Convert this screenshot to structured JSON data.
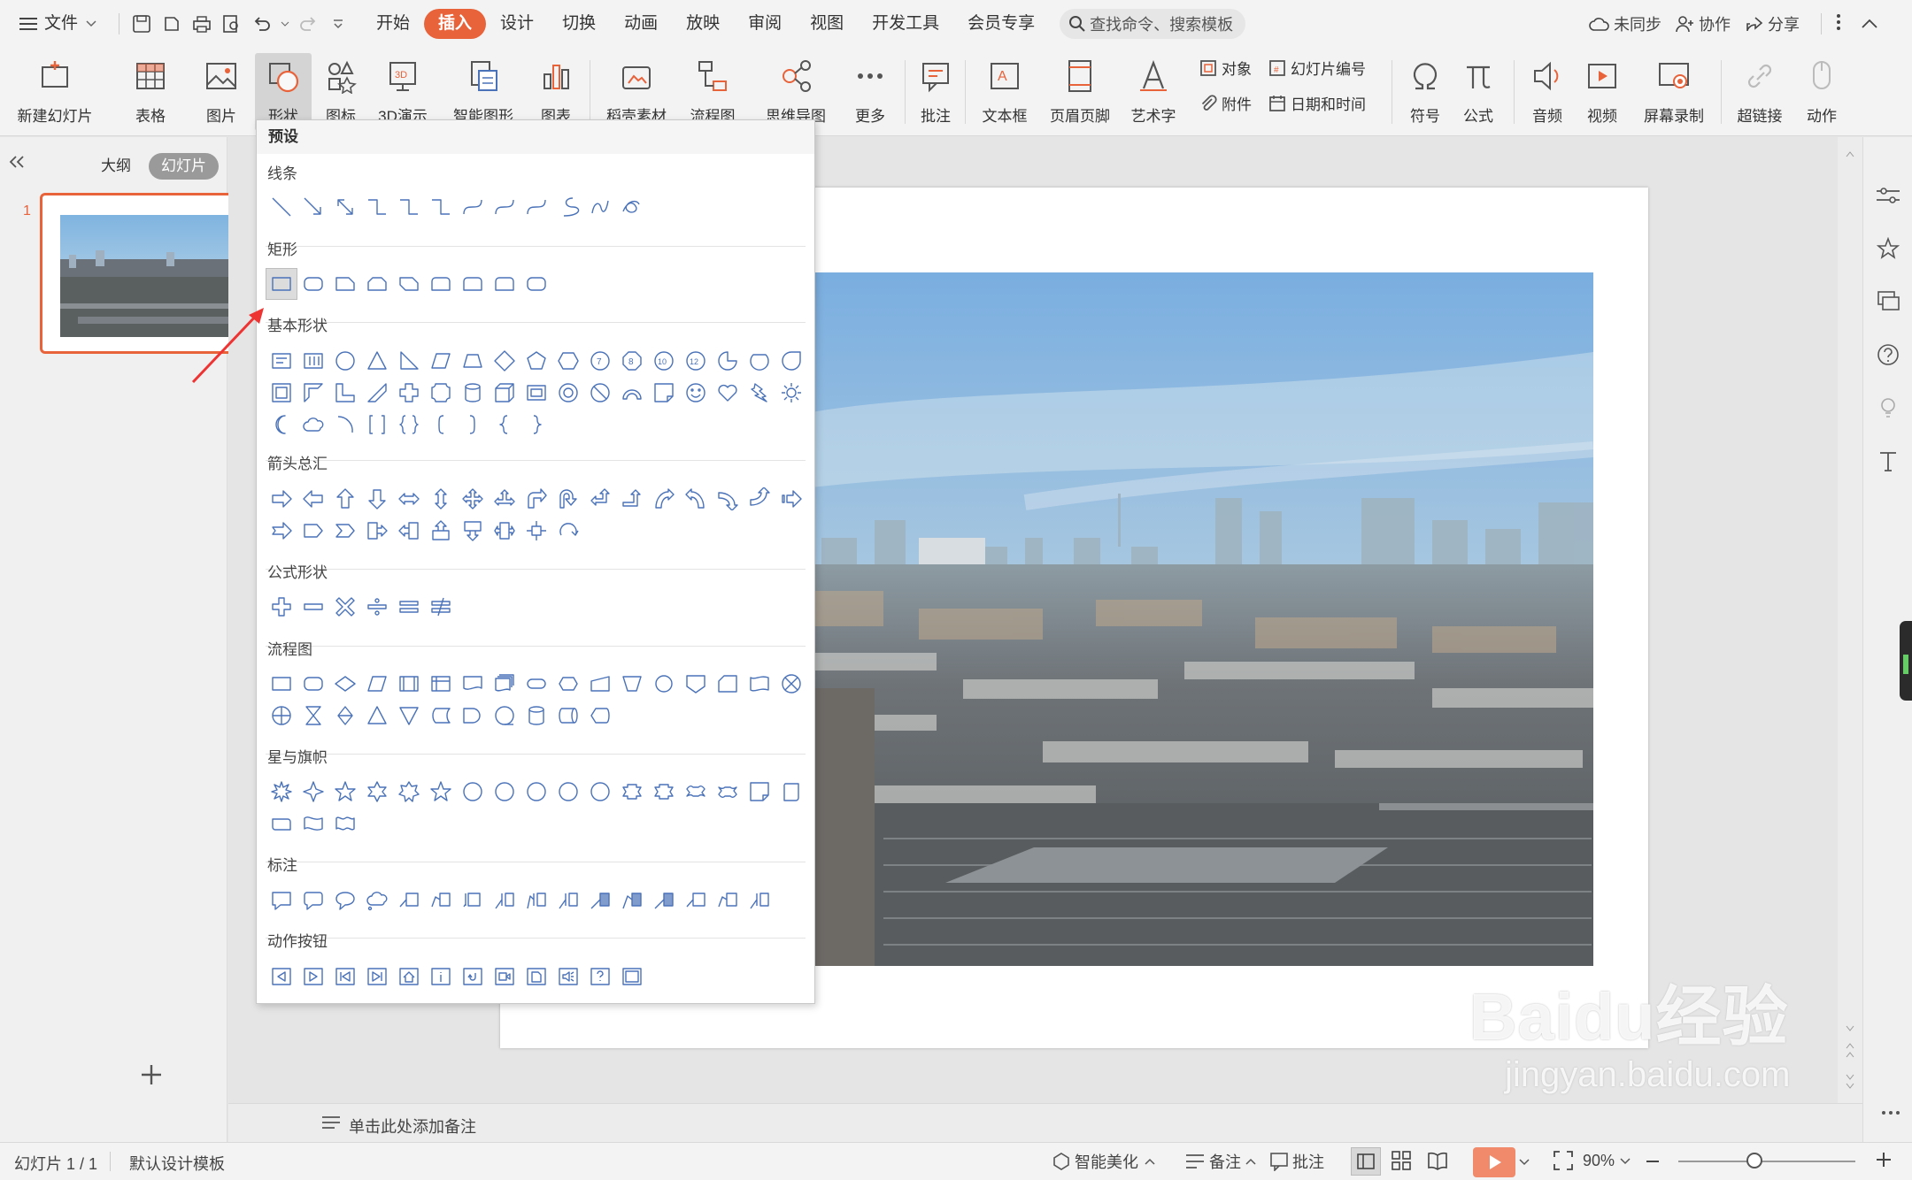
{
  "titlebar": {
    "file_menu": "文件",
    "tabs": [
      "开始",
      "插入",
      "设计",
      "切换",
      "动画",
      "放映",
      "审阅",
      "视图",
      "开发工具",
      "会员专享"
    ],
    "active_tab": "插入",
    "search_placeholder": "查找命令、搜索模板",
    "sync": "未同步",
    "collab": "协作",
    "share": "分享"
  },
  "ribbon": {
    "new_slide": "新建幻灯片",
    "table": "表格",
    "picture": "图片",
    "shape": "形状",
    "icon": "图标",
    "threed": "3D演示",
    "smartart": "智能图形",
    "chart": "图表",
    "stock": "稻壳素材",
    "flowchart": "流程图",
    "mindmap": "思维导图",
    "more": "更多",
    "comment": "批注",
    "textbox": "文本框",
    "header_footer": "页眉页脚",
    "wordart": "艺术字",
    "object": "对象",
    "attachment": "附件",
    "slide_number": "幻灯片编号",
    "datetime": "日期和时间",
    "symbol": "符号",
    "formula": "公式",
    "audio": "音频",
    "video": "视频",
    "screen_record": "屏幕录制",
    "hyperlink": "超链接",
    "action": "动作"
  },
  "left_panel": {
    "tab_outline": "大纲",
    "tab_slides": "幻灯片",
    "slide_number": "1"
  },
  "notes": {
    "placeholder": "单击此处添加备注"
  },
  "dropdown": {
    "title": "预设",
    "categories": {
      "lines": "线条",
      "rect": "矩形",
      "basic": "基本形状",
      "arrows": "箭头总汇",
      "equation": "公式形状",
      "flow": "流程图",
      "stars": "星与旗帜",
      "callouts": "标注",
      "actions": "动作按钮"
    }
  },
  "status": {
    "slide_info": "幻灯片 1 / 1",
    "template": "默认设计模板",
    "beautify": "智能美化",
    "notes_btn": "备注",
    "comment_btn": "批注",
    "zoom": "90%"
  },
  "watermark": {
    "brand": "Baidu经验",
    "url": "jingyan.baidu.com"
  },
  "colors": {
    "accent": "#e8623a",
    "shape_icon": "#4a72b8",
    "selection": "#e8623a"
  }
}
